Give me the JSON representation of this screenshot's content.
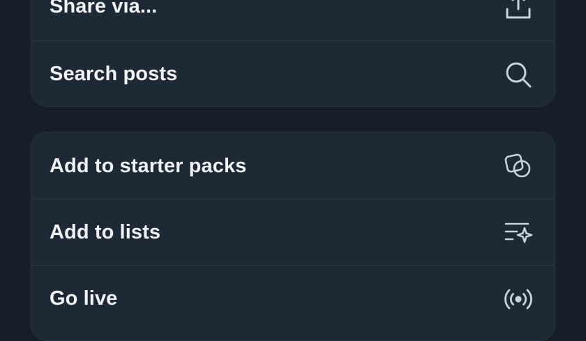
{
  "menu": {
    "group1": [
      {
        "label": "Share via...",
        "icon": "share-icon"
      },
      {
        "label": "Search posts",
        "icon": "search-icon"
      }
    ],
    "group2": [
      {
        "label": "Add to starter packs",
        "icon": "starter-pack-icon"
      },
      {
        "label": "Add to lists",
        "icon": "list-sparkle-icon"
      },
      {
        "label": "Go live",
        "icon": "broadcast-icon"
      }
    ]
  },
  "colors": {
    "background": "#161e27",
    "card": "#1e2936",
    "text": "#f1f3f5",
    "icon": "#c9d2dc"
  }
}
